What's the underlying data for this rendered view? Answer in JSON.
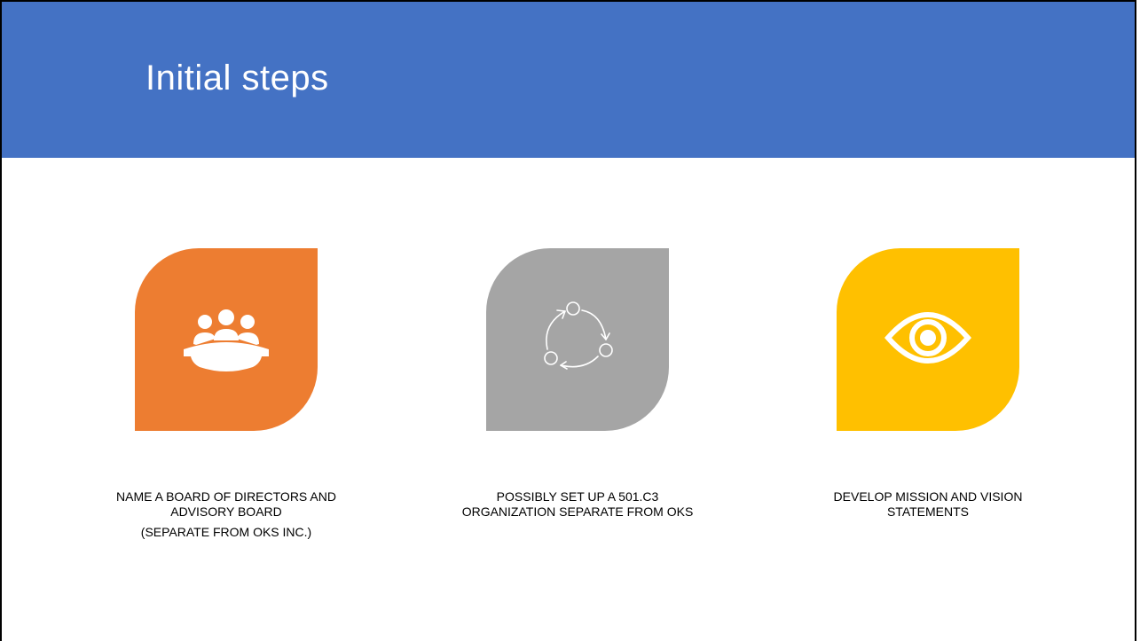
{
  "slide": {
    "title": "Initial steps",
    "header_color": "#4472c4"
  },
  "steps": [
    {
      "icon": "meeting-board-icon",
      "color": "#ed7d31",
      "caption": "NAME A BOARD OF DIRECTORS AND\nADVISORY BOARD",
      "subcaption": "(SEPARATE  FROM OKS INC.)"
    },
    {
      "icon": "cycle-arrows-icon",
      "color": "#a5a5a5",
      "caption": "POSSIBLY SET UP A 501.C3\nORGANIZATION SEPARATE FROM OKS",
      "subcaption": ""
    },
    {
      "icon": "eye-icon",
      "color": "#ffc000",
      "caption": "DEVELOP MISSION AND VISION\nSTATEMENTS",
      "subcaption": ""
    }
  ]
}
